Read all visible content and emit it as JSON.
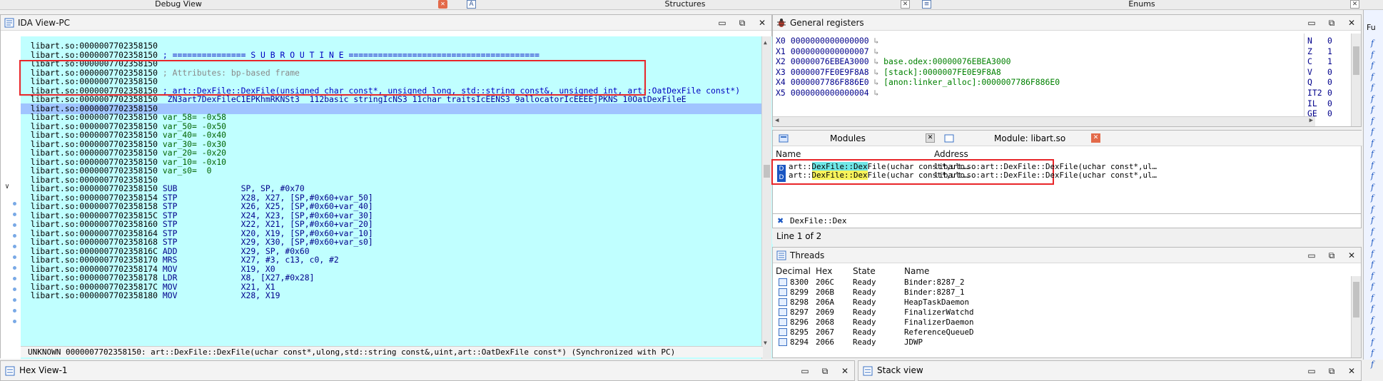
{
  "top_tabs": {
    "debug_view": "Debug View",
    "structures": "Structures",
    "enums": "Enums",
    "struct_glyph": "A"
  },
  "ida": {
    "title": "IDA View-PC",
    "lines": [
      {
        "addr": "libart.so:0000007702358150",
        "rest": "",
        "kind": "plain"
      },
      {
        "addr": "libart.so:0000007702358150",
        "rest": " ; =============== S U B R O U T I N E =======================================",
        "kind": "cmt"
      },
      {
        "addr": "libart.so:0000007702358150",
        "rest": "",
        "kind": "plain"
      },
      {
        "addr": "libart.so:0000007702358150",
        "rest": " ; Attributes: bp-based frame",
        "kind": "gray"
      },
      {
        "addr": "libart.so:0000007702358150",
        "rest": "",
        "kind": "plain"
      },
      {
        "addr": "libart.so:0000007702358150",
        "rest": " ; art::DexFile::DexFile(unsigned char const*, unsigned long, std::string const&, unsigned int, art::OatDexFile const*)",
        "kind": "cmt"
      },
      {
        "addr": "libart.so:0000007702358150",
        "rest": " _ZN3art7DexFileC1EPKhmRKNSt3__112basic_stringIcNS3_11char_traitsIcEENS3_9allocatorIcEEEEjPKNS_10OatDexFileE",
        "kind": "sym"
      },
      {
        "addr": "libart.so:0000007702358150",
        "rest": "",
        "kind": "hl"
      },
      {
        "addr": "libart.so:0000007702358150",
        "rest": " var_58= -0x58",
        "kind": "var"
      },
      {
        "addr": "libart.so:0000007702358150",
        "rest": " var_50= -0x50",
        "kind": "var"
      },
      {
        "addr": "libart.so:0000007702358150",
        "rest": " var_40= -0x40",
        "kind": "var"
      },
      {
        "addr": "libart.so:0000007702358150",
        "rest": " var_30= -0x30",
        "kind": "var"
      },
      {
        "addr": "libart.so:0000007702358150",
        "rest": " var_20= -0x20",
        "kind": "var"
      },
      {
        "addr": "libart.so:0000007702358150",
        "rest": " var_10= -0x10",
        "kind": "var"
      },
      {
        "addr": "libart.so:0000007702358150",
        "rest": " var_s0=  0",
        "kind": "var"
      },
      {
        "addr": "libart.so:0000007702358150",
        "rest": "",
        "kind": "plain"
      },
      {
        "addr": "libart.so:0000007702358150",
        "rest": " SUB             SP, SP, #0x70",
        "kind": "ins"
      },
      {
        "addr": "libart.so:0000007702358154",
        "rest": " STP             X28, X27, [SP,#0x60+var_50]",
        "kind": "ins"
      },
      {
        "addr": "libart.so:0000007702358158",
        "rest": " STP             X26, X25, [SP,#0x60+var_40]",
        "kind": "ins"
      },
      {
        "addr": "libart.so:000000770235815C",
        "rest": " STP             X24, X23, [SP,#0x60+var_30]",
        "kind": "ins"
      },
      {
        "addr": "libart.so:0000007702358160",
        "rest": " STP             X22, X21, [SP,#0x60+var_20]",
        "kind": "ins"
      },
      {
        "addr": "libart.so:0000007702358164",
        "rest": " STP             X20, X19, [SP,#0x60+var_10]",
        "kind": "ins"
      },
      {
        "addr": "libart.so:0000007702358168",
        "rest": " STP             X29, X30, [SP,#0x60+var_s0]",
        "kind": "ins"
      },
      {
        "addr": "libart.so:000000770235816C",
        "rest": " ADD             X29, SP, #0x60",
        "kind": "ins"
      },
      {
        "addr": "libart.so:0000007702358170",
        "rest": " MRS             X27, #3, c13, c0, #2",
        "kind": "ins"
      },
      {
        "addr": "libart.so:0000007702358174",
        "rest": " MOV             X19, X0",
        "kind": "ins"
      },
      {
        "addr": "libart.so:0000007702358178",
        "rest": " LDR             X8, [X27,#0x28]",
        "kind": "ins"
      },
      {
        "addr": "libart.so:000000770235817C",
        "rest": " MOV             X21, X1",
        "kind": "ins"
      },
      {
        "addr": "libart.so:0000007702358180",
        "rest": " MOV             X28, X19",
        "kind": "ins"
      }
    ],
    "status": "UNKNOWN 0000007702358150: art::DexFile::DexFile(uchar const*,ulong,std::string const&,uint,art::OatDexFile const*) (Synchronized with PC)"
  },
  "registers": {
    "title": "General registers",
    "rows": [
      {
        "name": "X0",
        "value": "0000000000000000",
        "comment": ""
      },
      {
        "name": "X1",
        "value": "0000000000000007",
        "comment": ""
      },
      {
        "name": "X2",
        "value": "00000076EBEA3000",
        "comment": "base.odex:00000076EBEA3000"
      },
      {
        "name": "X3",
        "value": "0000007FE0E9F8A8",
        "comment": "[stack]:0000007FE0E9F8A8"
      },
      {
        "name": "X4",
        "value": "0000007786F886E0",
        "comment": "[anon:linker_alloc]:0000007786F886E0"
      },
      {
        "name": "X5",
        "value": "0000000000000004",
        "comment": ""
      }
    ],
    "flags": [
      {
        "name": "N",
        "value": "0"
      },
      {
        "name": "Z",
        "value": "1"
      },
      {
        "name": "C",
        "value": "1"
      },
      {
        "name": "V",
        "value": "0"
      },
      {
        "name": "Q",
        "value": "0"
      },
      {
        "name": "IT2",
        "value": "0"
      },
      {
        "name": "IL",
        "value": "0"
      },
      {
        "name": "GE",
        "value": "0"
      }
    ]
  },
  "modules": {
    "tab_modules": "Modules",
    "tab_module_libart": "Module: libart.so",
    "col_name": "Name",
    "col_address": "Address",
    "rows": [
      {
        "name_pre": "art::",
        "name_mark": "DexFile::Dex",
        "name_post": "File(uchar const*,ulo…",
        "address": "libart.so:art::DexFile::DexFile(uchar const*,ul…",
        "mark": "cyan"
      },
      {
        "name_pre": "art::",
        "name_mark": "DexFile::Dex",
        "name_post": "File(uchar const*,ulo…",
        "address": "libart.so:art::DexFile::DexFile(uchar const*,ul…",
        "mark": "yellow"
      }
    ],
    "filter": "DexFile::Dex",
    "line_count": "Line 1 of 2"
  },
  "threads": {
    "title": "Threads",
    "col_decimal": "Decimal",
    "col_hex": "Hex",
    "col_state": "State",
    "col_name": "Name",
    "rows": [
      {
        "decimal": "8300",
        "hex": "206C",
        "state": "Ready",
        "name": "Binder:8287_2"
      },
      {
        "decimal": "8299",
        "hex": "206B",
        "state": "Ready",
        "name": "Binder:8287_1"
      },
      {
        "decimal": "8298",
        "hex": "206A",
        "state": "Ready",
        "name": "HeapTaskDaemon"
      },
      {
        "decimal": "8297",
        "hex": "2069",
        "state": "Ready",
        "name": "FinalizerWatchd"
      },
      {
        "decimal": "8296",
        "hex": "2068",
        "state": "Ready",
        "name": "FinalizerDaemon"
      },
      {
        "decimal": "8295",
        "hex": "2067",
        "state": "Ready",
        "name": "ReferenceQueueD"
      },
      {
        "decimal": "8294",
        "hex": "2066",
        "state": "Ready",
        "name": "JDWP"
      }
    ]
  },
  "far_right": {
    "label": "Fu",
    "glyph": "f"
  },
  "bottom": {
    "hex_title": "Hex View-1",
    "stack_title": "Stack view"
  },
  "colors": {
    "code_bg": "#c0ffff",
    "highlight_box": "#e8262a",
    "mark_cyan": "#6fe8e8",
    "mark_yellow": "#f7f35a"
  }
}
